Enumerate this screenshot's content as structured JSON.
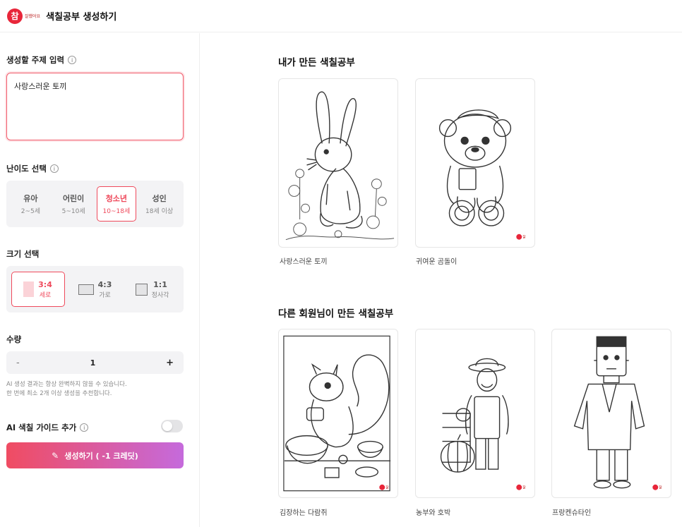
{
  "header": {
    "logo_char": "참",
    "logo_sub": "잘했어요",
    "title": "색칠공부 생성하기"
  },
  "sidebar": {
    "topic": {
      "label": "생성할 주제 입력",
      "value": "사랑스러운 토끼"
    },
    "difficulty": {
      "label": "난이도 선택",
      "options": [
        {
          "name": "유아",
          "range": "2~5세"
        },
        {
          "name": "어린이",
          "range": "5~10세"
        },
        {
          "name": "청소년",
          "range": "10~18세"
        },
        {
          "name": "성인",
          "range": "18세 이상"
        }
      ],
      "selected": "청소년"
    },
    "size": {
      "label": "크기 선택",
      "options": [
        {
          "ratio": "3:4",
          "name": "세로"
        },
        {
          "ratio": "4:3",
          "name": "가로"
        },
        {
          "ratio": "1:1",
          "name": "정사각"
        }
      ],
      "selected": "3:4"
    },
    "quantity": {
      "label": "수량",
      "minus": "-",
      "value": "1",
      "plus": "+"
    },
    "note": {
      "line1": "AI 생성 결과는 항상 완벽하지 않을 수 있습니다.",
      "line2": "한 번에 최소 2개 이상 생성을 추천합니다."
    },
    "guide": {
      "label": "AI 색칠 가이드 추가",
      "enabled": false
    },
    "generate": {
      "label": "생성하기 ( -1 크레딧)",
      "gradient_start": "#f04c62",
      "gradient_end": "#c56adc"
    }
  },
  "main": {
    "mine": {
      "title": "내가 만든 색칠공부",
      "items": [
        {
          "label": "사랑스러운 토끼",
          "image": "rabbit-coloring-page"
        },
        {
          "label": "귀여운 곰돌이",
          "image": "teddy-bear-coloring-page"
        }
      ]
    },
    "others": {
      "title": "다른 회원님이 만든 색칠공부",
      "items": [
        {
          "label": "김장하는 다람쥐",
          "image": "squirrel-coloring-page"
        },
        {
          "label": "농부와 호박",
          "image": "farmer-pumpkin-coloring-page"
        },
        {
          "label": "프랑켄슈타인",
          "image": "frankenstein-coloring-page"
        }
      ]
    }
  },
  "colors": {
    "accent": "#ef4a5c"
  }
}
